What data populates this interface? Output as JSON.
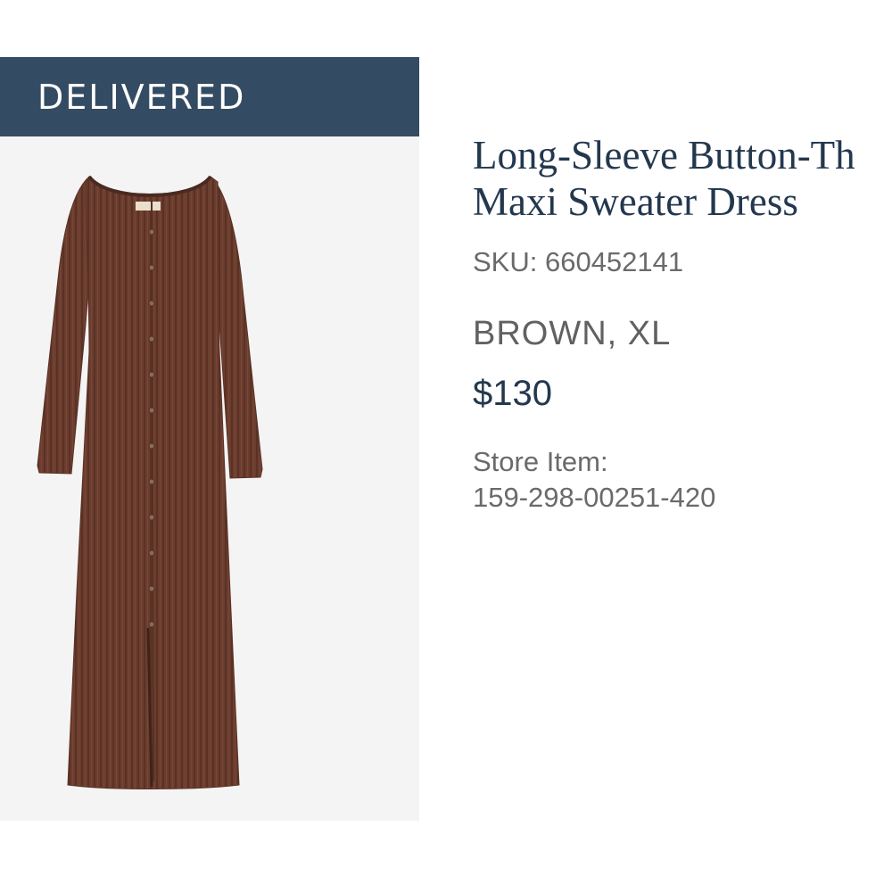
{
  "order": {
    "status": "DELIVERED"
  },
  "product": {
    "image_alt": "Brown ribbed long-sleeve button-through maxi sweater dress",
    "title_line1": "Long-Sleeve Button-Th",
    "title_line2": "Maxi Sweater Dress",
    "sku": "SKU: 660452141",
    "variant": "BROWN, XL",
    "price": "$130",
    "store_item_label": "Store Item:",
    "store_item_number": "159-298-00251-420"
  },
  "colors": {
    "banner": "#344c63",
    "title": "#23384e",
    "dress": "#6b3d2e"
  }
}
